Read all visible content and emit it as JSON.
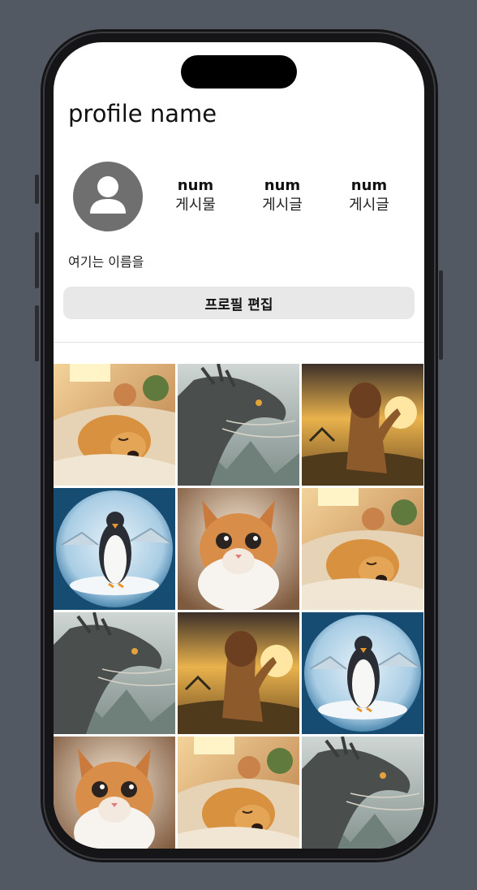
{
  "profile": {
    "name": "profile name",
    "bio": "여기는 이름을",
    "edit_button_label": "프로필 편집"
  },
  "stats": [
    {
      "value": "num",
      "label": "게시물"
    },
    {
      "value": "num",
      "label": "게시글"
    },
    {
      "value": "num",
      "label": "게시글"
    }
  ],
  "grid": [
    "sleeping-puppy",
    "dragon",
    "lion",
    "penguin",
    "cat",
    "sleeping-puppy",
    "dragon",
    "lion",
    "penguin",
    "cat",
    "sleeping-puppy",
    "dragon"
  ],
  "colors": {
    "background": "#535962",
    "button": "#e8e8e8",
    "avatar": "#6f6f6f"
  }
}
